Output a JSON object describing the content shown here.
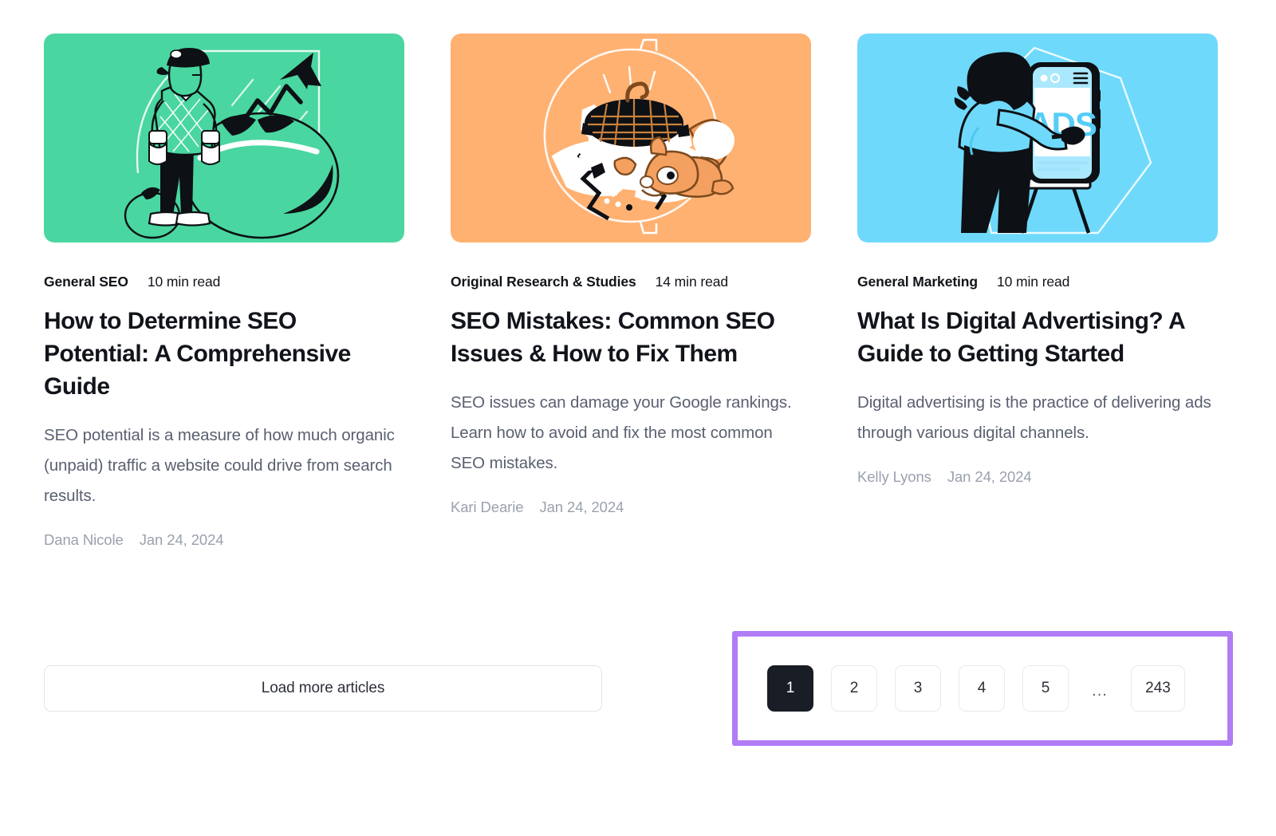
{
  "articles": [
    {
      "thumb_color": "#4ad6a0",
      "thumb_icon": "farmer-tomatoes-growth-arrow-illustration",
      "category": "General SEO",
      "read_time": "10 min read",
      "title": "How to Determine SEO Potential: A Comprehensive Guide",
      "description": "SEO potential is a measure of how much organic (unpaid) traffic a website could drive from search results.",
      "author": "Dana Nicole",
      "date": "Jan 24, 2024"
    },
    {
      "thumb_color": "#ffb172",
      "thumb_icon": "squirrel-broken-waffle-gear-illustration",
      "category": "Original Research & Studies",
      "read_time": "14 min read",
      "title": "SEO Mistakes: Common SEO Issues & How to Fix Them",
      "description": "SEO issues can damage your Google rankings. Learn how to avoid and fix the most common SEO mistakes.",
      "author": "Kari Dearie",
      "date": "Jan 24, 2024"
    },
    {
      "thumb_color": "#6fd9fb",
      "thumb_icon": "person-painting-ads-on-phone-easel-illustration",
      "category": "General Marketing",
      "read_time": "10 min read",
      "title": "What Is Digital Advertising? A Guide to Getting Started",
      "description": "Digital advertising is the practice of delivering ads through various digital channels.",
      "author": "Kelly Lyons",
      "date": "Jan 24, 2024"
    }
  ],
  "footer": {
    "load_more_label": "Load more articles"
  },
  "pagination": {
    "highlight_color": "#b07df5",
    "active_page": "1",
    "pages": [
      "1",
      "2",
      "3",
      "4",
      "5"
    ],
    "ellipsis": "...",
    "last_page": "243"
  },
  "illustration_text": {
    "ads_label": "ADS"
  }
}
